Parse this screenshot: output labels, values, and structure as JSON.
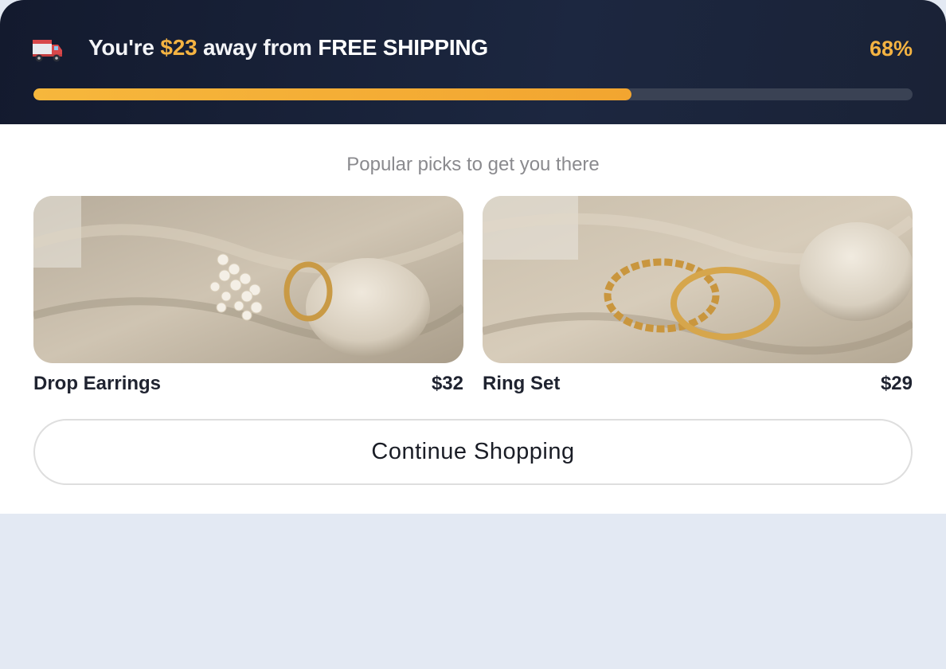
{
  "banner": {
    "truck_icon": "delivery-truck-icon",
    "text_prefix": "You're",
    "amount": "$23",
    "text_middle": "away from",
    "text_emphasis": "FREE SHIPPING",
    "percent_label": "68%",
    "progress_fraction": 0.68,
    "accent_color": "#f4b342"
  },
  "recommendations": {
    "heading": "Popular picks to get you there",
    "products": [
      {
        "name": "Drop Earrings",
        "price": "$32",
        "image": "pearl-hoop-earrings-photo"
      },
      {
        "name": "Ring Set",
        "price": "$29",
        "image": "gold-ring-set-photo"
      }
    ]
  },
  "actions": {
    "continue_label": "Continue Shopping"
  }
}
